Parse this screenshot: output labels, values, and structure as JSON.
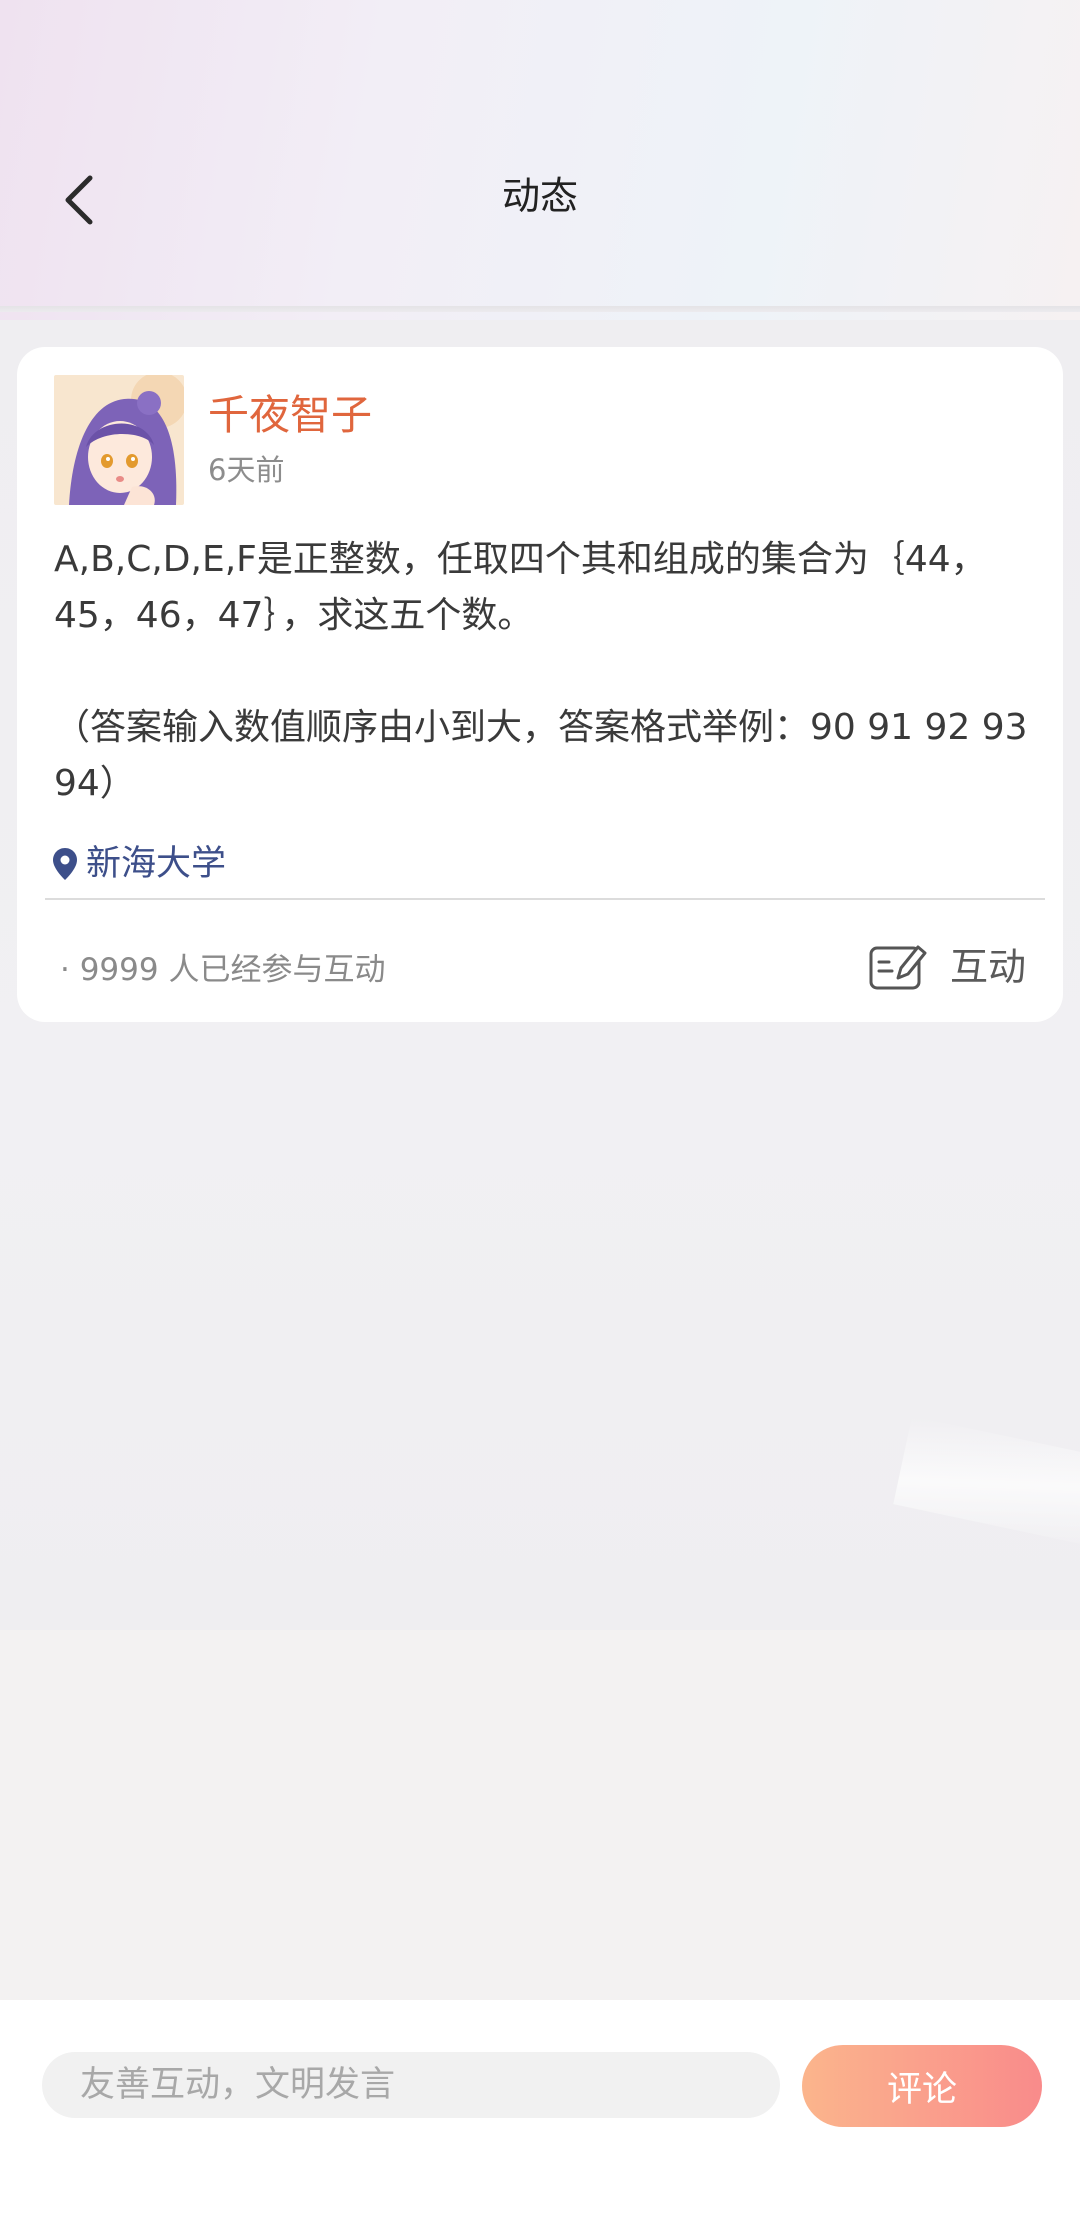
{
  "header": {
    "title": "动态"
  },
  "post": {
    "author_name": "千夜智子",
    "time": "6天前",
    "body": "A,B,C,D,E,F是正整数，任取四个其和组成的集合为｛44，45，46，47｝，求这五个数。\n\n（答案输入数值顺序由小到大，答案格式举例：90 91 92 93 94）",
    "location": "新海大学",
    "participants_text": "· 9999  人已经参与互动",
    "interact_label": "互动"
  },
  "comment_bar": {
    "input_placeholder": "友善互动，文明发言",
    "input_value": "",
    "submit_label": "评论"
  },
  "colors": {
    "author_name": "#e0663d",
    "location": "#3d4f8a",
    "button_gradient_start": "#fbb58c",
    "button_gradient_end": "#f98b8b"
  },
  "icons": {
    "back": "chevron-left-icon",
    "location": "location-pin-icon",
    "interact": "edit-note-icon"
  }
}
